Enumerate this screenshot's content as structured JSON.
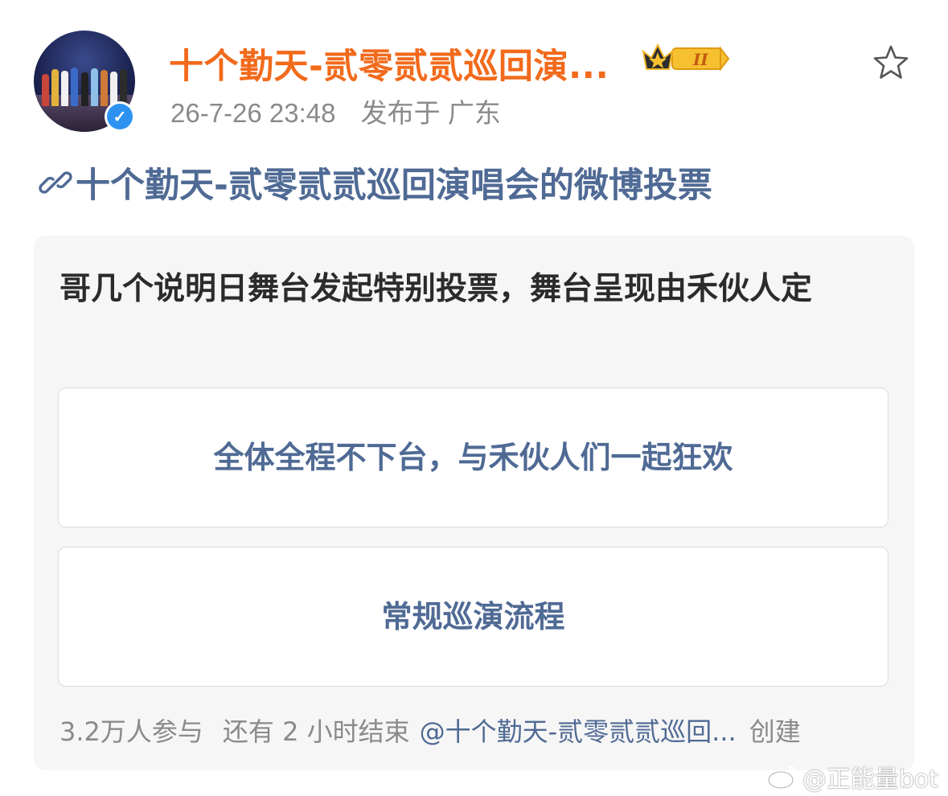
{
  "post": {
    "username": "十个勤天-贰零贰贰巡回演...",
    "badge_text": "II",
    "timestamp": "26-7-26 23:48",
    "location": "发布于 广东",
    "link_title": "十个勤天-贰零贰贰巡回演唱会的微博投票"
  },
  "poll": {
    "question": "哥几个说明日舞台发起特别投票，舞台呈现由禾伙人定",
    "options": [
      {
        "label": "全体全程不下台，与禾伙人们一起狂欢"
      },
      {
        "label": "常规巡演流程"
      }
    ],
    "participants": "3.2万人参与",
    "time_left": "还有 2 小时结束",
    "creator": "@十个勤天-贰零贰贰巡回...",
    "create_label": "创建"
  },
  "watermark": "@正能量bot",
  "icons": {
    "favorite": "star-outline-icon",
    "link": "link-icon",
    "verified": "verified-icon",
    "badge": "crown-level-badge-icon",
    "weibo": "weibo-logo-icon"
  },
  "colors": {
    "username": "#f26a1b",
    "link": "#4f6a94",
    "meta": "#8a8a8a",
    "poll_bg": "#f6f6f6",
    "verified": "#2e93f0"
  }
}
